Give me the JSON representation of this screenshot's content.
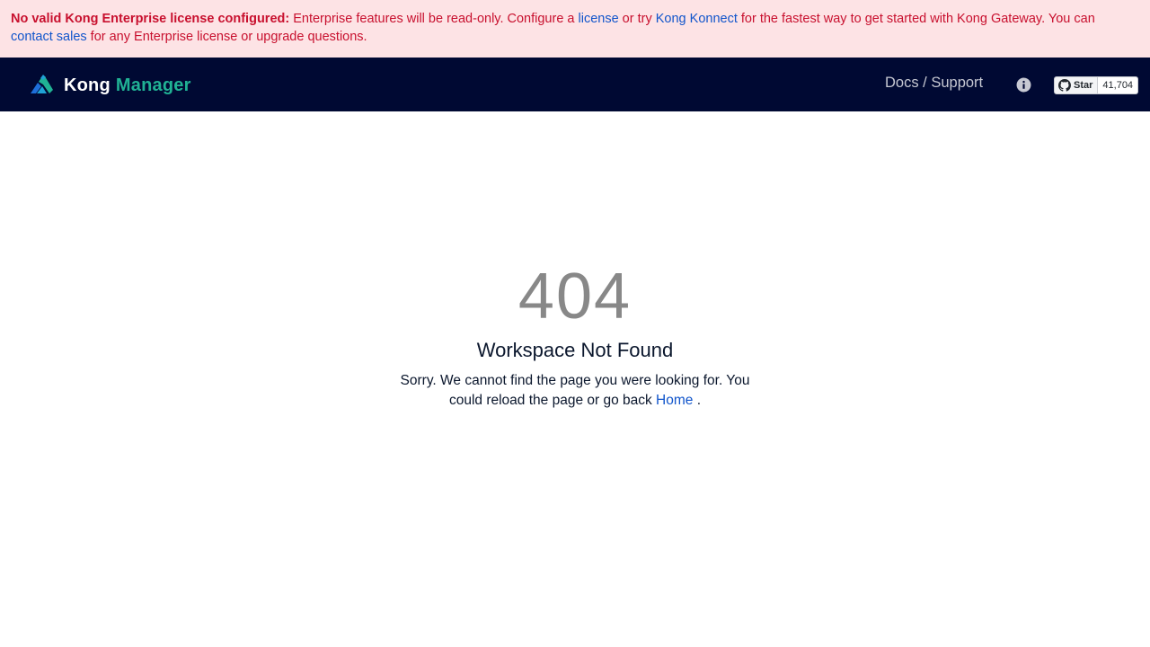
{
  "banner": {
    "strong": "No valid Kong Enterprise license configured:",
    "text1": " Enterprise features will be read-only. Configure a ",
    "license_link": "license",
    "text2": " or try ",
    "konnect_link": "Kong Konnect",
    "text3": " for the fastest way to get started with Kong Gateway. You can ",
    "contact_link": "contact sales",
    "text4": " for any Enterprise license or upgrade questions."
  },
  "navbar": {
    "brand_kong": "Kong",
    "brand_manager": "Manager",
    "docs_label": "Docs / Support",
    "info_icon": "info-icon",
    "github": {
      "star_label": "Star",
      "star_count": "41,704"
    }
  },
  "error": {
    "code": "404",
    "title": "Workspace Not Found",
    "message_prefix": "Sorry. We cannot find the page you were looking for. You could reload the page or go back ",
    "home_link": "Home",
    "message_suffix": " ."
  },
  "colors": {
    "banner_bg": "#fde3e5",
    "banner_text": "#c8102e",
    "link": "#1155cb",
    "navbar_bg": "#000933",
    "brand_accent": "#20b294"
  }
}
